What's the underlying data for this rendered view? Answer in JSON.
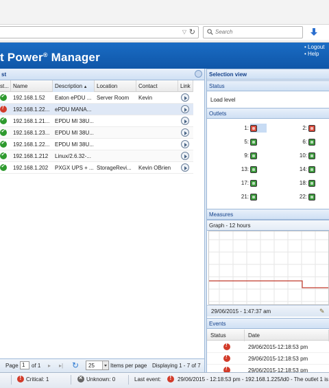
{
  "browser": {
    "search_placeholder": "Search"
  },
  "app": {
    "title": "t Power",
    "title_reg": "®",
    "title_suffix": " Manager",
    "logout_label": "• Logout",
    "help_label": "• Help"
  },
  "list": {
    "title": "st",
    "columns": [
      "st...",
      "Name",
      "Description",
      "Location",
      "Contact",
      "Link"
    ],
    "rows": [
      {
        "status": "ok",
        "name": "192.168.1.52",
        "description": "Eaton ePDU ...",
        "location": "Server Room",
        "contact": "Kevin"
      },
      {
        "status": "critical",
        "name": "192.168.1.22...",
        "description": "ePDU MANA...",
        "location": "",
        "contact": ""
      },
      {
        "status": "ok",
        "name": "192.168.1.21...",
        "description": "EPDU MI 38U...",
        "location": "",
        "contact": ""
      },
      {
        "status": "ok",
        "name": "192.168.1.23...",
        "description": "EPDU MI 38U...",
        "location": "",
        "contact": ""
      },
      {
        "status": "ok",
        "name": "192.168.1.22...",
        "description": "EPDU MI 38U...",
        "location": "",
        "contact": ""
      },
      {
        "status": "ok",
        "name": "192.168.1.212",
        "description": "Linux/2.6.32-...",
        "location": "",
        "contact": ""
      },
      {
        "status": "ok",
        "name": "192.168.1.202",
        "description": "PXGX UPS + ...",
        "location": "StorageRevi...",
        "contact": "Kevin OBrien"
      }
    ]
  },
  "pager": {
    "page_label": "Page",
    "page_value": "1",
    "of_label": "of 1",
    "per_page_value": "25",
    "per_page_label": "Items per page",
    "displaying": "Displaying 1 - 7 of 7"
  },
  "selection": {
    "title": "Selection view",
    "status_header": "Status",
    "load_level": "Load level",
    "outlets_header": "Outlets",
    "outlets": [
      {
        "n": "1:",
        "state": "off"
      },
      {
        "n": "2:",
        "state": "off"
      },
      {
        "n": "5:",
        "state": "on"
      },
      {
        "n": "6:",
        "state": "on"
      },
      {
        "n": "9:",
        "state": "on"
      },
      {
        "n": "10:",
        "state": "on"
      },
      {
        "n": "13:",
        "state": "on"
      },
      {
        "n": "14:",
        "state": "on"
      },
      {
        "n": "17:",
        "state": "on"
      },
      {
        "n": "18:",
        "state": "on"
      },
      {
        "n": "21:",
        "state": "on"
      },
      {
        "n": "22:",
        "state": "on"
      }
    ],
    "measures_header": "Measures",
    "graph_header": "Graph - 12 hours",
    "graph_timestamp": "29/06/2015 - 1:47:37 am",
    "events_header": "Events",
    "events_col_status": "Status",
    "events_col_date": "Date",
    "events": [
      {
        "date": "29/06/2015-12:18:53 pm"
      },
      {
        "date": "29/06/2015-12:18:53 pm"
      },
      {
        "date": "29/06/2015-12:18:53 pm"
      }
    ]
  },
  "statusbar": {
    "critical": "Critical: 1",
    "unknown": "Unknown: 0",
    "last_event_label": "Last event:",
    "last_event_text": "29/06/2015 - 12:18:53 pm - 192.168.1.225/ld0 - The outlet 1 is"
  },
  "colors": {
    "header_blue": "#1462b8",
    "critical_red": "#d23b2a",
    "ok_green": "#2e9a2e",
    "graph_line": "#c0392b"
  }
}
